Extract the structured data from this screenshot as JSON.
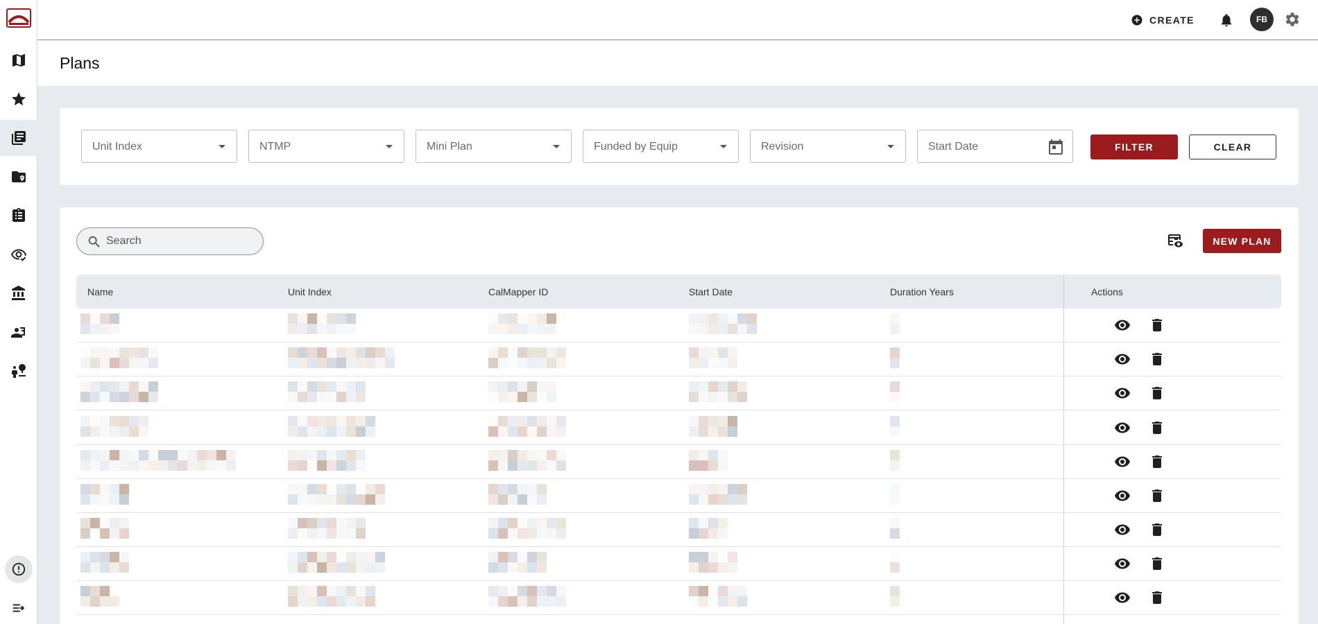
{
  "app": {
    "title": "Plans",
    "colors": {
      "brand": "#9b1c1f",
      "background": "#e8ebee"
    }
  },
  "sidebar": {
    "items": [
      {
        "icon": "map-icon"
      },
      {
        "icon": "star-icon"
      },
      {
        "icon": "plans-icon",
        "active": true
      },
      {
        "icon": "folder-location-icon"
      },
      {
        "icon": "clipboard-icon"
      },
      {
        "icon": "eye-check-icon"
      },
      {
        "icon": "bank-icon"
      },
      {
        "icon": "contact-card-icon"
      },
      {
        "icon": "person-tree-icon"
      }
    ],
    "bottom": [
      {
        "icon": "info-icon"
      },
      {
        "icon": "expand-icon"
      }
    ]
  },
  "topbar": {
    "create_label": "CREATE",
    "avatar_initials": "FB"
  },
  "filters": {
    "unit_index_placeholder": "Unit Index",
    "ntmp_placeholder": "NTMP",
    "mini_plan_placeholder": "Mini Plan",
    "funded_by_equip_placeholder": "Funded by Equip",
    "revision_placeholder": "Revision",
    "start_date_placeholder": "Start Date",
    "filter_label": "FILTER",
    "clear_label": "CLEAR"
  },
  "table": {
    "search_placeholder": "Search",
    "new_plan_label": "NEW PLAN",
    "columns": [
      "Name",
      "Unit Index",
      "CalMapper ID",
      "Start Date",
      "Duration Years",
      "Actions"
    ],
    "row_count": 9
  }
}
